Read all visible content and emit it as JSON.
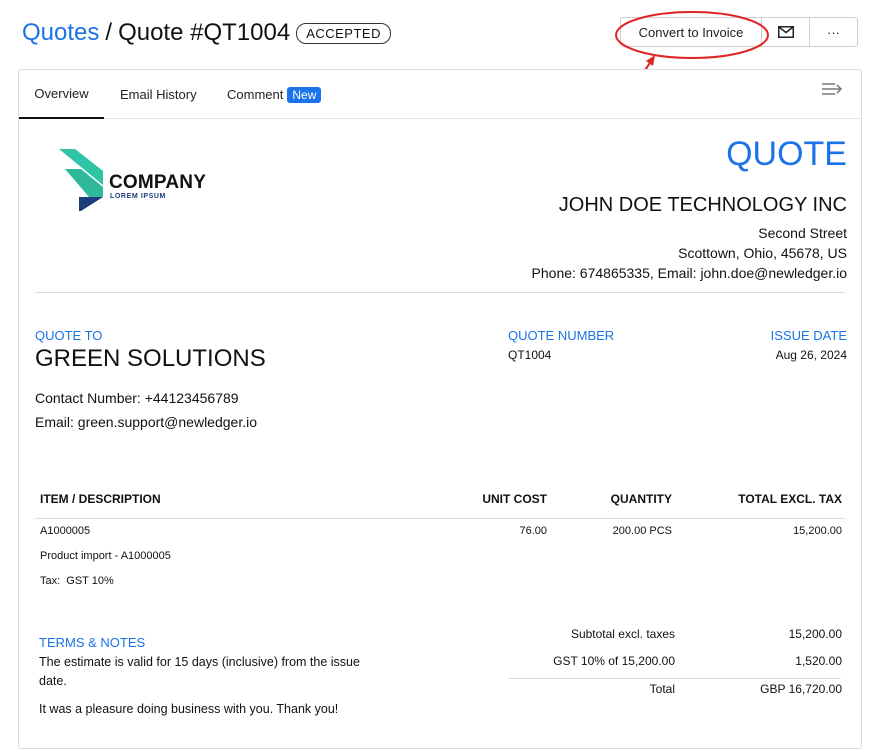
{
  "header": {
    "breadcrumb_link": "Quotes",
    "separator": "/",
    "title": "Quote #QT1004",
    "status": "ACCEPTED"
  },
  "actions": {
    "convert_label": "Convert to Invoice",
    "email_icon": "mail-icon",
    "more_label": "···"
  },
  "tabs": [
    {
      "label": "Overview",
      "active": true
    },
    {
      "label": "Email History"
    },
    {
      "label": "Comment",
      "badge": "New"
    }
  ],
  "logo": {
    "name": "COMPANY",
    "tagline": "LOREM IPSUM"
  },
  "document": {
    "heading": "QUOTE",
    "seller": {
      "name": "JOHN DOE TECHNOLOGY INC",
      "street": "Second Street",
      "city": "Scottown, Ohio, 45678, US",
      "contact": "Phone: 674865335, Email: john.doe@newledger.io"
    },
    "quote_to_label": "QUOTE TO",
    "client": {
      "name": "GREEN SOLUTIONS",
      "contact_number": "Contact Number: +44123456789",
      "email": "Email: green.support@newledger.io"
    },
    "quote_number_label": "QUOTE NUMBER",
    "quote_number": "QT1004",
    "issue_date_label": "ISSUE DATE",
    "issue_date": "Aug 26, 2024"
  },
  "items_table": {
    "headers": [
      "ITEM / DESCRIPTION",
      "UNIT COST",
      "QUANTITY",
      "TOTAL EXCL. TAX"
    ],
    "rows": [
      {
        "code": "A1000005",
        "description": "Product import - A1000005",
        "tax": "Tax:  GST 10%",
        "unit_cost": "76.00",
        "quantity": "200.00 PCS",
        "total": "15,200.00"
      }
    ]
  },
  "totals": {
    "subtotal_label": "Subtotal excl. taxes",
    "subtotal_value": "15,200.00",
    "tax_label": "GST 10% of 15,200.00",
    "tax_value": "1,520.00",
    "total_label": "Total",
    "total_value": "GBP 16,720.00"
  },
  "notes": {
    "label": "TERMS & NOTES",
    "line1": "The estimate is valid for 15 days (inclusive) from the issue date.",
    "line2": "It was a pleasure doing business with you. Thank you!"
  },
  "colors": {
    "accent": "#1a73e8",
    "annotation": "#e02424",
    "logo_teal": "#2ec4a6",
    "logo_navy": "#1a3d7c"
  }
}
